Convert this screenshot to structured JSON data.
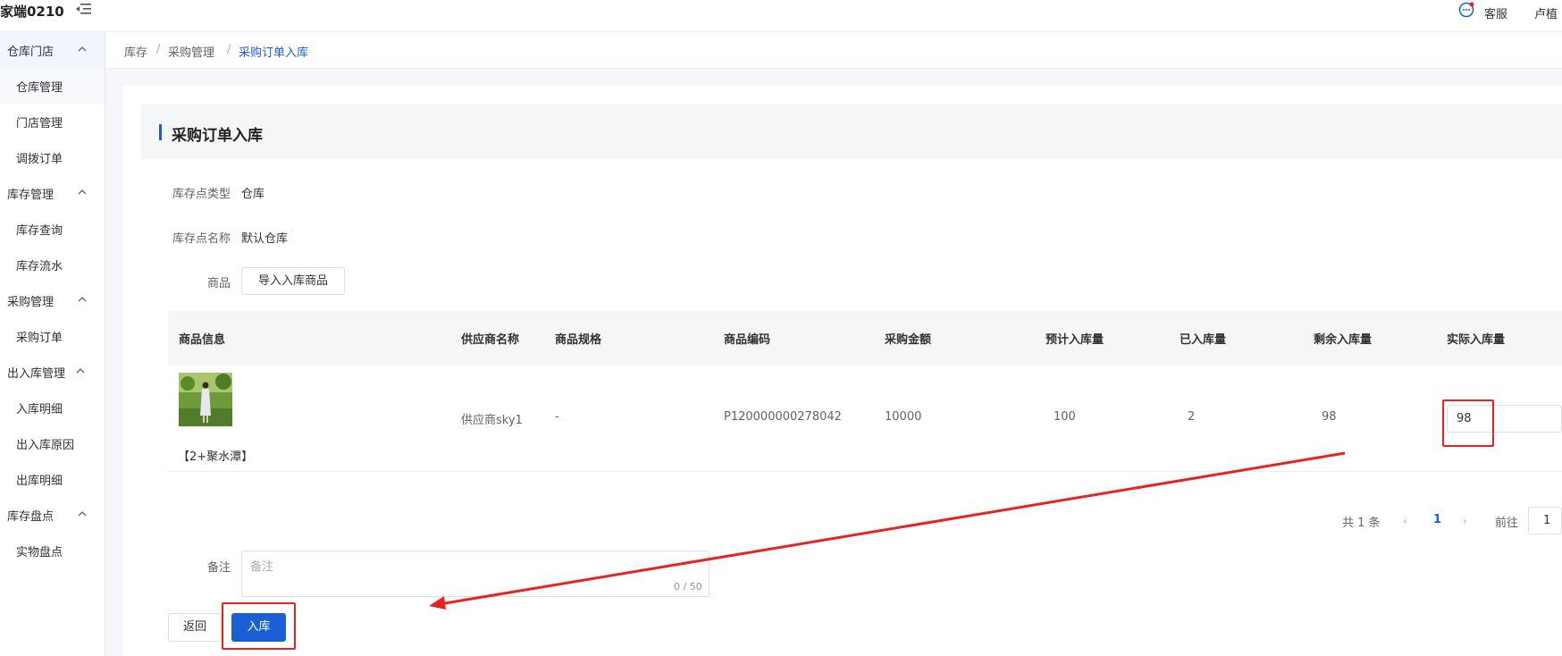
{
  "header": {
    "app_title": "家端0210",
    "kefu_label": "客服",
    "user_label": "卢植"
  },
  "sidebar": {
    "groups": [
      {
        "label": "仓库门店",
        "items": [
          "仓库管理",
          "门店管理",
          "调拨订单"
        ]
      },
      {
        "label": "库存管理",
        "items": [
          "库存查询",
          "库存流水"
        ]
      },
      {
        "label": "采购管理",
        "items": [
          "采购订单"
        ]
      },
      {
        "label": "出入库管理",
        "items": [
          "入库明细",
          "出入库原因",
          "出库明细"
        ]
      },
      {
        "label": "库存盘点",
        "items": [
          "实物盘点"
        ]
      }
    ]
  },
  "breadcrumb": [
    "库存",
    "采购管理",
    "采购订单入库"
  ],
  "page": {
    "title": "采购订单入库",
    "fields": {
      "type_label": "库存点类型",
      "type_value": "仓库",
      "name_label": "库存点名称",
      "name_value": "默认仓库",
      "goods_label": "商品",
      "import_button": "导入入库商品"
    }
  },
  "table": {
    "headers": [
      "商品信息",
      "供应商名称",
      "商品规格",
      "商品编码",
      "采购金额",
      "预计入库量",
      "已入库量",
      "剩余入库量",
      "实际入库量"
    ],
    "rows": [
      {
        "product_name": "【2+聚水潭】",
        "supplier": "供应商sky1",
        "spec": "-",
        "code": "P120000000278042",
        "amount": "10000",
        "expected": "100",
        "received": "2",
        "remaining": "98",
        "actual": "98"
      }
    ]
  },
  "pagination": {
    "total": "共 1 条",
    "current": "1",
    "goto_label": "前往",
    "goto_value": "1"
  },
  "remark": {
    "label": "备注",
    "placeholder": "备注",
    "counter": "0 / 50"
  },
  "actions": {
    "back": "返回",
    "submit": "入库"
  },
  "colors": {
    "primary": "#1a5fd6",
    "annotation_red": "#e8231f"
  }
}
